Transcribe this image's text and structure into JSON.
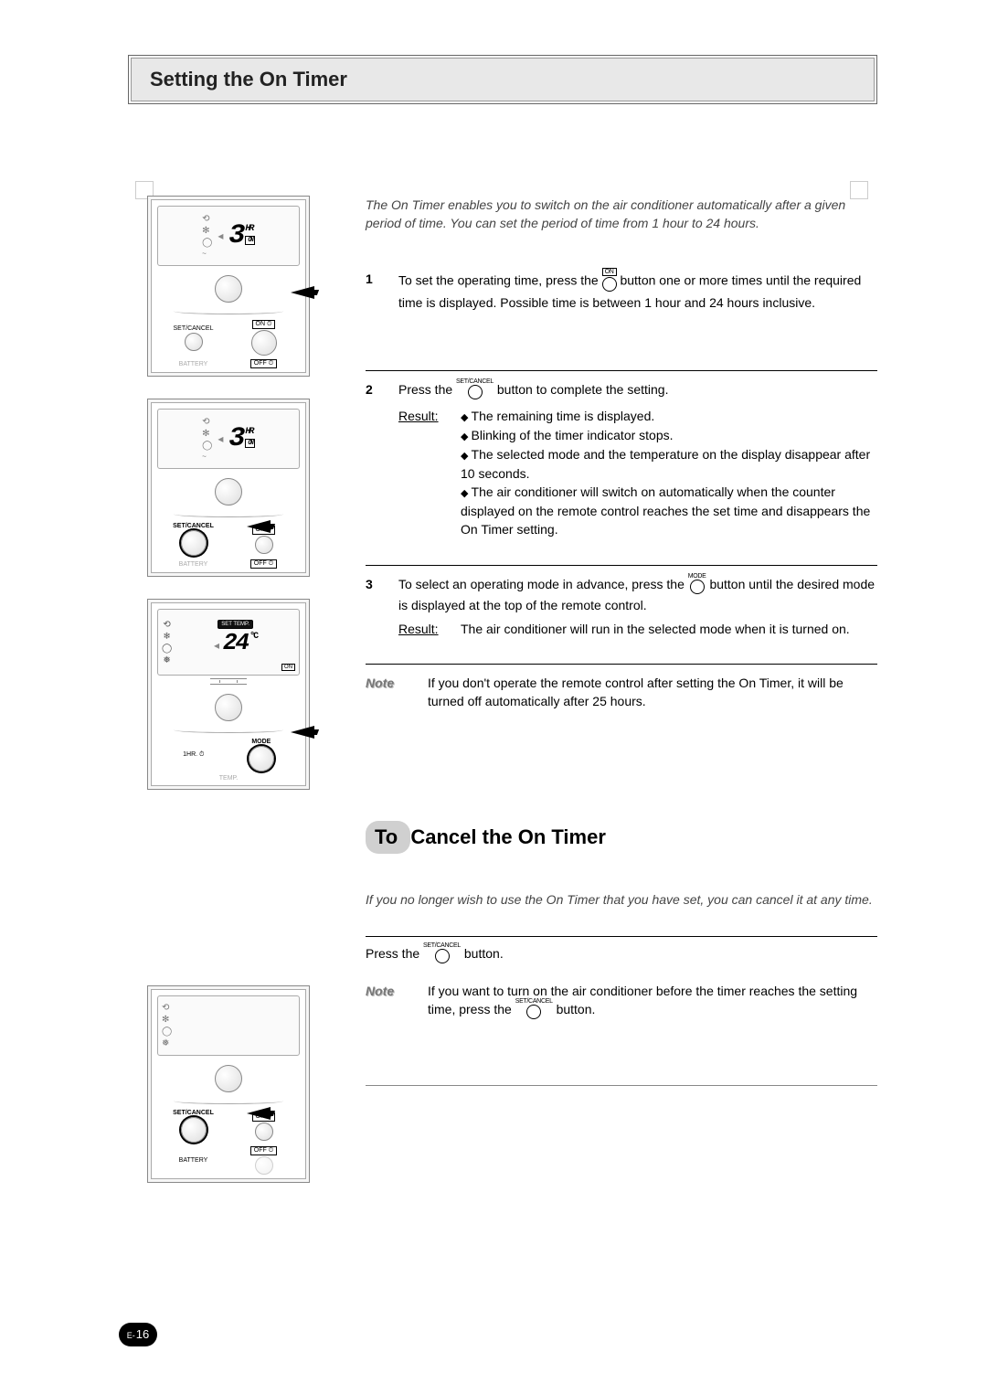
{
  "page": {
    "number_prefix": "E-",
    "number": "16"
  },
  "title": "Setting the On Timer",
  "intro": "The On Timer enables you to switch on the air conditioner automatically after a given period of time. You can set the period of time from 1 hour to 24 hours.",
  "icons": {
    "on_timer": "ON",
    "set_cancel": "SET/CANCEL",
    "mode": "MODE"
  },
  "steps": {
    "s1": {
      "num": "1",
      "text_a": "To set the operating time, press the ",
      "text_b": " button one or more times until the required time is displayed. Possible time is between 1 hour and 24 hours inclusive."
    },
    "s2": {
      "num": "2",
      "text_a": "Press the ",
      "text_b": " button to complete the setting.",
      "result_label": "Result:",
      "results": {
        "r1": "The remaining time is displayed.",
        "r2": "Blinking of the timer indicator stops.",
        "r3": "The selected mode and the temperature on the display disappear after 10 seconds.",
        "r4": "The air conditioner will switch on automatically when the counter displayed on the remote control reaches the set time and disappears the On Timer setting."
      }
    },
    "s3": {
      "num": "3",
      "text_a": "To select an operating mode in advance, press the ",
      "text_b": " button until the desired mode is displayed at the top of the remote control.",
      "result_label": "Result:",
      "result_text": "The air conditioner will run in the selected mode when it is turned on."
    }
  },
  "note1": {
    "label": "Note",
    "text": "If you don't operate the remote control after setting the On Timer, it will be turned off automatically after 25 hours."
  },
  "cancel": {
    "title_pill": "To",
    "title_rest": " Cancel the On Timer",
    "intro": "If you no longer wish to use the On Timer that you have set, you can cancel it at any time.",
    "press_a": "Press the ",
    "press_b": " button.",
    "note_label": "Note",
    "note_a": "If you want to turn on the air conditioner before the timer reaches the setting time, press the ",
    "note_b": " button."
  },
  "remote": {
    "hr_value": "3",
    "hr_label": "HR",
    "on_box": "ON",
    "set_cancel": "SET/CANCEL",
    "on_label": "ON",
    "off_label": "OFF",
    "battery": "BATTERY",
    "set_temp": "SET TEMP.",
    "temp_value": "24",
    "temp_unit": "°C",
    "one_hr": "1HR.",
    "mode": "MODE",
    "temp_btn": "TEMP."
  }
}
